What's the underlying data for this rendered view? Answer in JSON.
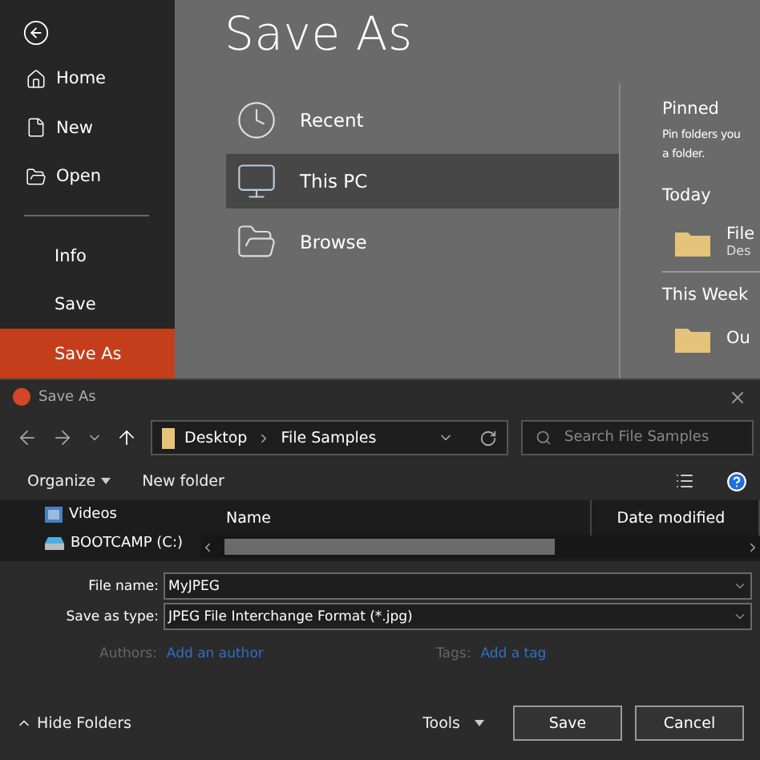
{
  "backstage": {
    "title": "Save As",
    "nav_primary": [
      {
        "label": "Home",
        "selected": false
      },
      {
        "label": "New",
        "selected": false
      },
      {
        "label": "Open",
        "selected": false
      }
    ],
    "nav_secondary": [
      {
        "label": "Info",
        "selected": false
      },
      {
        "label": "Save",
        "selected": false
      },
      {
        "label": "Save As",
        "selected": true
      }
    ],
    "locations": [
      {
        "label": "Recent",
        "selected": false
      },
      {
        "label": "This PC",
        "selected": true
      },
      {
        "label": "Browse",
        "selected": false
      }
    ],
    "pinned": {
      "title": "Pinned",
      "hint_lines": [
        "Pin folders you",
        "a folder."
      ],
      "groups": [
        {
          "heading": "Today",
          "items": [
            {
              "name": "File",
              "location": "Des"
            }
          ]
        },
        {
          "heading": "This Week",
          "items": [
            {
              "name": "Ou"
            }
          ]
        }
      ]
    }
  },
  "dialog": {
    "title": "Save As",
    "address": [
      "Desktop",
      "File Samples"
    ],
    "search": {
      "placeholder": "Search File Samples"
    },
    "toolbar": {
      "organize": "Organize",
      "new_folder": "New folder"
    },
    "tree": [
      {
        "label": "Videos",
        "kind": "videos"
      },
      {
        "label": "BOOTCAMP (C:)",
        "kind": "drive"
      }
    ],
    "columns": [
      "Name",
      "Date modified"
    ],
    "fields": [
      {
        "label": "File name:",
        "value": "MyJPEG"
      },
      {
        "label": "Save as type:",
        "value": "JPEG File Interchange Format (*.jpg)"
      }
    ],
    "meta": [
      {
        "label": "Authors:",
        "link": "Add an author"
      },
      {
        "label": "Tags:",
        "link": "Add a tag"
      }
    ],
    "hide_folders": "Hide Folders",
    "tools": "Tools",
    "buttons": [
      "Save",
      "Cancel"
    ]
  }
}
